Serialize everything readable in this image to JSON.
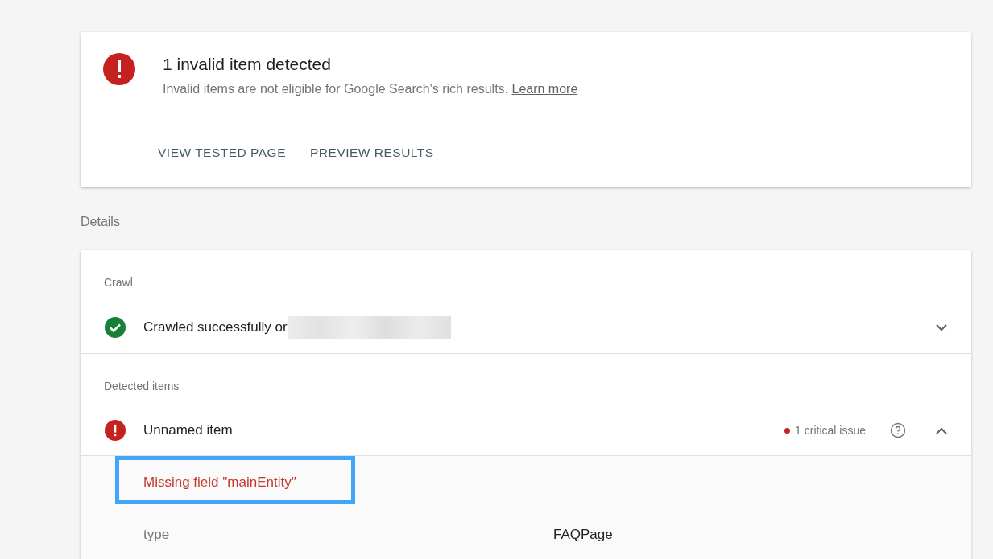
{
  "summary": {
    "kind": "error",
    "title": "1 invalid item detected",
    "description": "Invalid items are not eligible for Google Search's rich results.",
    "link": "Learn more",
    "actions": [
      "VIEW TESTED PAGE",
      "PREVIEW RESULTS"
    ]
  },
  "details_heading": "Details",
  "sections": [
    {
      "label": "Crawl",
      "items": [
        {
          "kind": "ok",
          "text": "Crawled successfully or",
          "redacted": true,
          "expanded": false
        }
      ]
    },
    {
      "label": "Detected items",
      "items": [
        {
          "kind": "error",
          "text": "Unnamed item",
          "issue": "1 critical issue",
          "expanded": true,
          "issues": [
            {
              "text": "Missing field \"mainEntity\"",
              "highlighted": true
            }
          ],
          "fields": [
            {
              "name": "type",
              "value": "FAQPage"
            }
          ]
        }
      ]
    }
  ]
}
